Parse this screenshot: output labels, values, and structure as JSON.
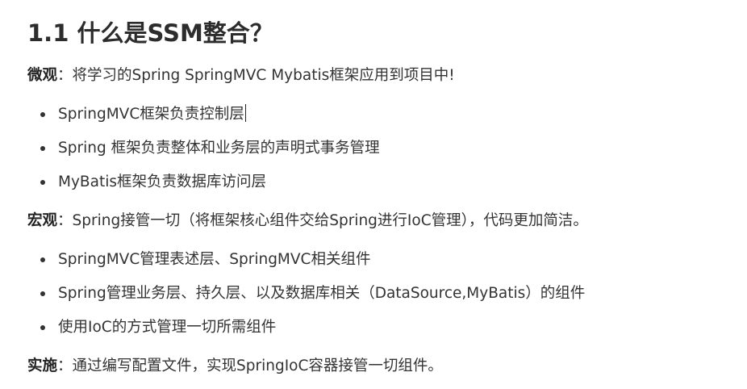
{
  "heading": "1.1 什么是SSM整合？",
  "micro": {
    "label": "微观",
    "text": "：将学习的Spring SpringMVC Mybatis框架应用到项目中!",
    "items": [
      "SpringMVC框架负责控制层",
      "Spring 框架负责整体和业务层的声明式事务管理",
      "MyBatis框架负责数据库访问层"
    ]
  },
  "macro": {
    "label": "宏观",
    "text": "：Spring接管一切（将框架核心组件交给Spring进行IoC管理），代码更加简洁。",
    "items": [
      "SpringMVC管理表述层、SpringMVC相关组件",
      "Spring管理业务层、持久层、以及数据库相关（DataSource,MyBatis）的组件",
      "使用IoC的方式管理一切所需组件"
    ]
  },
  "implementation": {
    "label": "实施",
    "text": "：通过编写配置文件，实现SpringIoC容器接管一切组件。"
  }
}
